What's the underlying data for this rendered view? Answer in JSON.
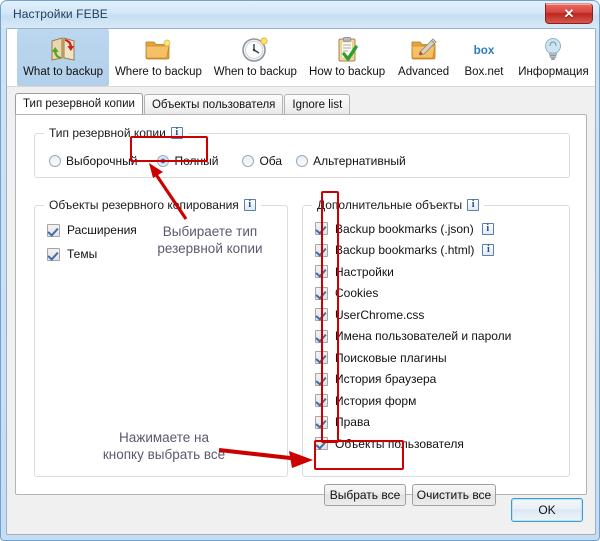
{
  "window": {
    "title": "Настройки FEBE",
    "close_label": "✕"
  },
  "toolbar": {
    "items": [
      {
        "label": "What to backup",
        "icon": "book-backup-icon",
        "selected": true
      },
      {
        "label": "Where to backup",
        "icon": "folder-icon",
        "selected": false
      },
      {
        "label": "When to backup",
        "icon": "clock-icon",
        "selected": false
      },
      {
        "label": "How to backup",
        "icon": "clipboard-check-icon",
        "selected": false
      },
      {
        "label": "Advanced",
        "icon": "folder-pencil-icon",
        "selected": false
      },
      {
        "label": "Box.net",
        "icon": "box-logo-icon",
        "selected": false
      },
      {
        "label": "Информация",
        "icon": "lightbulb-icon",
        "selected": false
      }
    ]
  },
  "tabs": [
    {
      "label": "Тип резервной копии",
      "active": true
    },
    {
      "label": "Объекты пользователя",
      "active": false
    },
    {
      "label": "Ignore list",
      "active": false
    }
  ],
  "backup_type_group": {
    "legend": "Тип резервной копии",
    "info_icon": "info-icon",
    "options": [
      {
        "label": "Выборочный",
        "checked": false
      },
      {
        "label": "Полный",
        "checked": true
      },
      {
        "label": "Оба",
        "checked": false
      },
      {
        "label": "Альтернативный",
        "checked": false
      }
    ]
  },
  "backup_objects_group": {
    "legend": "Объекты резервного копирования",
    "info_icon": "info-icon",
    "items": [
      {
        "label": "Расширения",
        "checked": true
      },
      {
        "label": "Темы",
        "checked": true
      }
    ]
  },
  "additional_objects_group": {
    "legend": "Дополнительные объекты",
    "info_icon": "info-icon",
    "items": [
      {
        "label": "Backup bookmarks (.json)",
        "checked": true,
        "info": true
      },
      {
        "label": "Backup bookmarks (.html)",
        "checked": true,
        "info": true
      },
      {
        "label": "Настройки",
        "checked": true,
        "info": false
      },
      {
        "label": "Cookies",
        "checked": true,
        "info": false
      },
      {
        "label": "UserChrome.css",
        "checked": true,
        "info": false
      },
      {
        "label": "Имена пользователей и пароли",
        "checked": true,
        "info": false
      },
      {
        "label": "Поисковые плагины",
        "checked": true,
        "info": false
      },
      {
        "label": "История браузера",
        "checked": true,
        "info": false
      },
      {
        "label": "История форм",
        "checked": true,
        "info": false
      },
      {
        "label": "Права",
        "checked": true,
        "info": false
      },
      {
        "label": "Объекты пользователя",
        "checked": true,
        "info": false
      }
    ],
    "select_all_label": "Выбрать все",
    "clear_all_label": "Очистить все"
  },
  "footer": {
    "ok_label": "OK"
  },
  "annotations": [
    {
      "name": "backup-type-note",
      "text": "Выбираете тип\nрезервной копии"
    },
    {
      "name": "select-all-note",
      "text": "Нажимаете на\nкнопку выбрать все"
    }
  ],
  "colors": {
    "annotation_red": "#cc0000",
    "annotation_text": "#5a5a6e",
    "selected_tab_bg": "#b2d0ea",
    "accent_blue": "#3c9ad9"
  }
}
